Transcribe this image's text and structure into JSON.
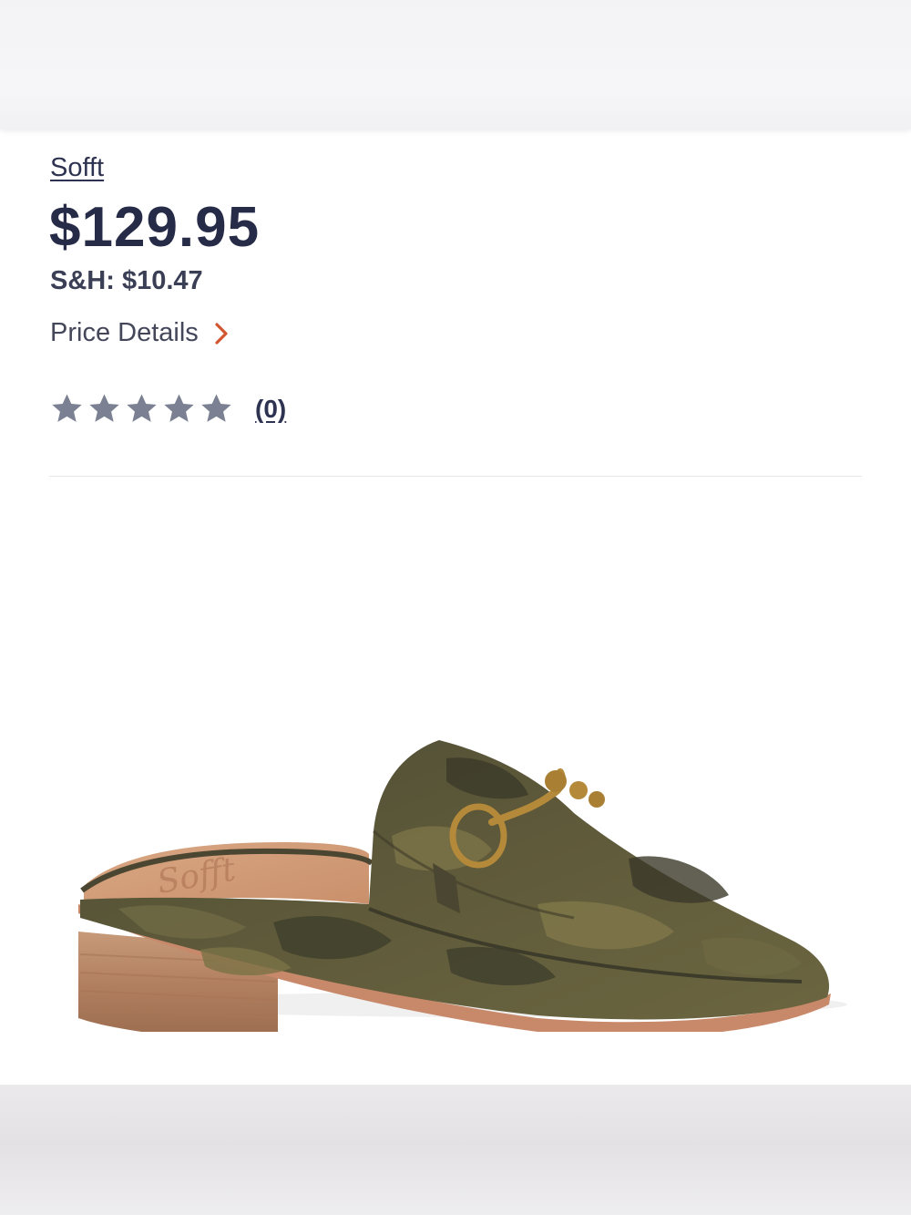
{
  "product": {
    "brand": "Sofft",
    "price": "$129.95",
    "shipping": "S&H: $10.47",
    "price_details_label": "Price Details",
    "rating": {
      "stars_filled": 0,
      "stars_total": 5,
      "review_count": "(0)"
    },
    "image": {
      "alt": "camo leather slip-on mule shoe with bit hardware"
    }
  },
  "colors": {
    "text_primary": "#262b48",
    "accent_chevron": "#d2562f",
    "star_empty": "#7b8192"
  }
}
